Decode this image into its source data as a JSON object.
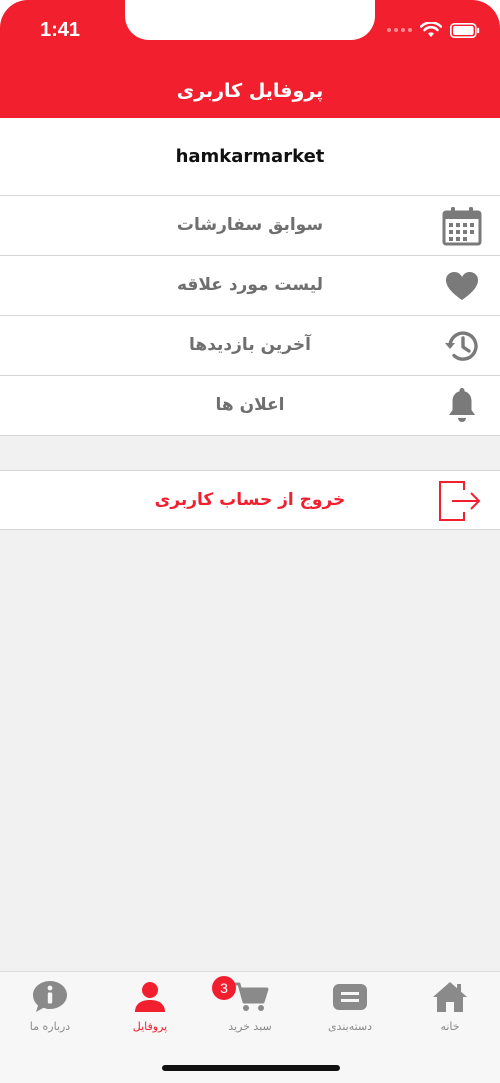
{
  "status_bar": {
    "time": "1:41"
  },
  "header": {
    "title": "پروفایل کاربری"
  },
  "profile": {
    "username": "hamkarmarket"
  },
  "menu": {
    "items": [
      {
        "label": "سوابق سفارشات",
        "icon": "calendar-icon"
      },
      {
        "label": "لیست مورد علاقه",
        "icon": "heart-icon"
      },
      {
        "label": "آخرین بازدیدها",
        "icon": "history-icon"
      },
      {
        "label": "اعلان ها",
        "icon": "bell-icon"
      }
    ]
  },
  "logout": {
    "label": "خروج از حساب کاربری",
    "icon": "logout-icon"
  },
  "tabbar": {
    "tabs": [
      {
        "label": "درباره ما",
        "icon": "info-icon"
      },
      {
        "label": "پروفایل",
        "icon": "user-icon",
        "active": true
      },
      {
        "label": "سبد خرید",
        "icon": "cart-icon",
        "badge": "3"
      },
      {
        "label": "دسته‌بندی",
        "icon": "category-icon"
      },
      {
        "label": "خانه",
        "icon": "home-icon"
      }
    ]
  },
  "colors": {
    "accent": "#f21f2f",
    "icon_gray": "#7a7a7a",
    "background": "#f1f1f1"
  }
}
